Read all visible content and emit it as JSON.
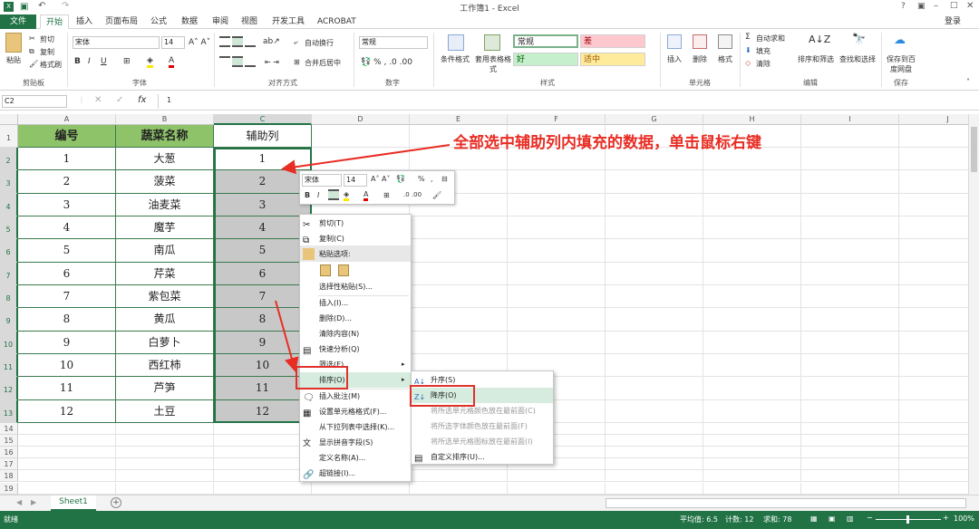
{
  "window": {
    "title": "工作簿1 - Excel",
    "login": "登录"
  },
  "menu": {
    "tabs": [
      "文件",
      "开始",
      "插入",
      "页面布局",
      "公式",
      "数据",
      "审阅",
      "视图",
      "开发工具",
      "ACROBAT"
    ],
    "active": "开始"
  },
  "ribbon": {
    "clipboard": {
      "paste": "粘贴",
      "cut": "剪切",
      "copy": "复制",
      "format_painter": "格式刷",
      "label": "剪贴板"
    },
    "font": {
      "name": "宋体",
      "size": "14",
      "label": "字体"
    },
    "align": {
      "wrap": "自动换行",
      "merge": "合并后居中",
      "label": "对齐方式"
    },
    "number": {
      "format": "常规",
      "label": "数字"
    },
    "styles": {
      "conditional": "条件格式",
      "table": "套用表格格式",
      "normal": "常规",
      "bad": "差",
      "good": "好",
      "neutral": "适中",
      "label": "样式"
    },
    "cells": {
      "insert": "插入",
      "delete": "删除",
      "format": "格式",
      "label": "单元格"
    },
    "editing": {
      "autosum": "自动求和",
      "fill": "填充",
      "clear": "清除",
      "sort": "排序和筛选",
      "find": "查找和选择",
      "label": "编辑"
    },
    "save": {
      "save_cloud": "保存到百度网盘",
      "label": "保存"
    }
  },
  "formula_bar": {
    "name_box": "C2",
    "value": "1",
    "fx": "fx"
  },
  "columns": [
    "A",
    "B",
    "C",
    "D",
    "E",
    "F",
    "G",
    "H",
    "I",
    "J"
  ],
  "table": {
    "headers": [
      "编号",
      "蔬菜名称",
      "辅助列"
    ],
    "rows": [
      [
        "1",
        "大葱",
        "1"
      ],
      [
        "2",
        "菠菜",
        "2"
      ],
      [
        "3",
        "油麦菜",
        "3"
      ],
      [
        "4",
        "魔芋",
        "4"
      ],
      [
        "5",
        "南瓜",
        "5"
      ],
      [
        "6",
        "芹菜",
        "6"
      ],
      [
        "7",
        "紫包菜",
        "7"
      ],
      [
        "8",
        "黄瓜",
        "8"
      ],
      [
        "9",
        "白萝卜",
        "9"
      ],
      [
        "10",
        "西红柿",
        "10"
      ],
      [
        "11",
        "芦笋",
        "11"
      ],
      [
        "12",
        "土豆",
        "12"
      ]
    ]
  },
  "row_numbers": [
    "1",
    "2",
    "3",
    "4",
    "5",
    "6",
    "7",
    "8",
    "9",
    "10",
    "11",
    "12",
    "13",
    "14",
    "15",
    "16",
    "17",
    "18",
    "19",
    "20"
  ],
  "annotation": "全部选中辅助列内填充的数据，单击鼠标右键",
  "mini_toolbar": {
    "font": "宋体",
    "size": "14"
  },
  "context_menu": {
    "items": [
      "剪切(T)",
      "复制(C)",
      "粘贴选项:",
      "",
      "选择性粘贴(S)...",
      "插入(I)...",
      "删除(D)...",
      "清除内容(N)",
      "快速分析(Q)",
      "筛选(E)",
      "排序(O)",
      "插入批注(M)",
      "设置单元格格式(F)...",
      "从下拉列表中选择(K)...",
      "显示拼音字段(S)",
      "定义名称(A)...",
      "超链接(I)..."
    ]
  },
  "sort_submenu": {
    "items": [
      "升序(S)",
      "降序(O)",
      "将所选单元格颜色放在最前面(C)",
      "将所选字体颜色放在最前面(F)",
      "将所选单元格图标放在最前面(I)",
      "自定义排序(U)..."
    ]
  },
  "sheet": {
    "tab": "Sheet1"
  },
  "status": {
    "ready": "就绪",
    "average": "平均值: 6.5",
    "count": "计数: 12",
    "sum": "求和: 78",
    "zoom": "100%"
  },
  "colors": {
    "excel_green": "#217346",
    "header_fill": "#8fc36a",
    "selection_fill": "#c8c8c8",
    "annotation_red": "#e82d24"
  }
}
